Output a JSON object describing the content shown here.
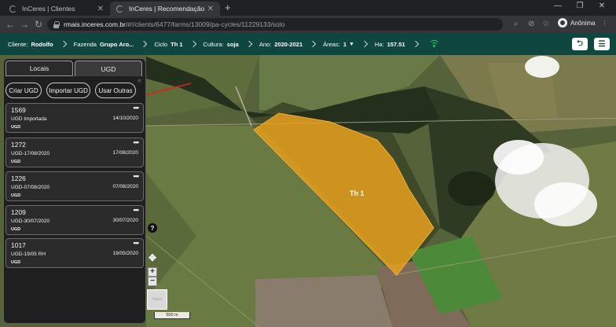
{
  "browser": {
    "tabs": [
      {
        "title": "InCeres | Clientes",
        "active": false
      },
      {
        "title": "InCeres | Recomendação",
        "active": true
      }
    ],
    "new_tab": "+",
    "url_host": "rmais.inceres.com.br",
    "url_path": "/#!/clients/6477/farms/13009/pa-cycles/11229133/solo",
    "profile_label": "Anônima",
    "window_controls": {
      "minimize": "—",
      "restore": "❐",
      "close": "✕"
    }
  },
  "header": {
    "cliente_label": "Cliente:",
    "cliente_value": "Rodolfo",
    "fazenda_label": "Fazenda",
    "fazenda_value": "Grupo Aro...",
    "ciclo_label": "Ciclo",
    "ciclo_value": "Th 1",
    "cultura_label": "Cultura:",
    "cultura_value": "soja",
    "ano_label": "Ano:",
    "ano_value": "2020-2021",
    "areas_label": "Áreas:",
    "areas_value": "1",
    "ha_label": "Ha:",
    "ha_value": "157.51",
    "back_icon": "arrow-left-icon",
    "menu_icon": "menu-icon",
    "status_color": "#19d14b"
  },
  "panel": {
    "tabs": {
      "locais": "Locais",
      "ugd": "UGD"
    },
    "buttons": {
      "criar": "Criar UGD",
      "importar": "Importar UGD",
      "usar": "Usar Outras"
    },
    "cards": [
      {
        "id": "1569",
        "name": "UGD Importada",
        "date": "14/10/2020",
        "type": "UGD"
      },
      {
        "id": "1272",
        "name": "UGD-17/08/2020",
        "date": "17/08/2020",
        "type": "UGD"
      },
      {
        "id": "1226",
        "name": "UGD-07/08/2020",
        "date": "07/08/2020",
        "type": "UGD"
      },
      {
        "id": "1209",
        "name": "UGD-30/07/2020",
        "date": "30/07/2020",
        "type": "UGD"
      },
      {
        "id": "1017",
        "name": "UGD-19/05 RH",
        "date": "19/05/2020",
        "type": "UGD"
      }
    ]
  },
  "map": {
    "field_label": "Th 1",
    "field_color": "#e8a01c",
    "annotation_color": "#e0201c",
    "help_label": "?",
    "zoom_in": "+",
    "zoom_out": "−",
    "thumb_label": "Mapa",
    "scale_label": "500 m"
  }
}
